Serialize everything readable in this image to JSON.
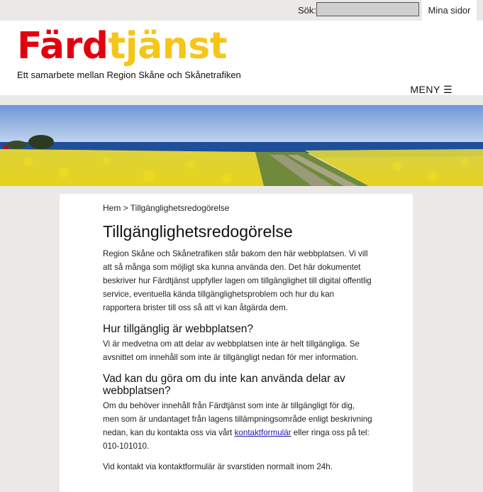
{
  "topbar": {
    "search_label": "Sök:",
    "search_value": "",
    "my_pages_label": "Mina sidor"
  },
  "header": {
    "logo_part1": "Färd",
    "logo_part2": "tjänst",
    "tagline": "Ett samarbete mellan Region Skåne och Skånetrafiken",
    "menu_label": "MENY ☰"
  },
  "colors": {
    "logo_red": "#e2000f",
    "logo_yellow": "#f5c518",
    "background": "#ebe9e7",
    "link": "#1a1ab0"
  },
  "content": {
    "breadcrumb": "Hem > Tillgänglighetsredogörelse",
    "title": "Tillgänglighetsredogörelse",
    "intro": "Region Skåne och Skånetrafiken står bakom den här webbplatsen. Vi vill att så många som möjligt ska kunna använda den. Det här dokumentet beskriver hur Färdtjänst uppfyller lagen om tillgänglighet till digital offentlig service, eventuella kända tillgänglighetsproblem och hur du kan rapportera brister till oss så att vi kan åtgärda dem.",
    "section1_heading": "Hur tillgänglig är webbplatsen?",
    "section1_text": "Vi är medvetna om att delar av webbplatsen inte är helt tillgängliga. Se avsnittet om innehåll som inte är tillgängligt nedan för mer information.",
    "section2_heading": "Vad kan du göra om du inte kan använda delar av webbplatsen?",
    "section2_text_before": "Om du behöver innehåll från Färdtjänst som inte är tillgängligt för dig, men som är undantaget från lagens tillämpningsområde enligt beskrivning nedan, kan du kontakta oss via vårt ",
    "section2_link": "kontaktformulär",
    "section2_text_after": " eller ringa oss på tel: 010-101010.",
    "section3_text": "Vid kontakt via kontaktformulär är svarstiden normalt inom 24h."
  },
  "hero_image": {
    "description_icon": "rapeseed-field-landscape-image"
  }
}
